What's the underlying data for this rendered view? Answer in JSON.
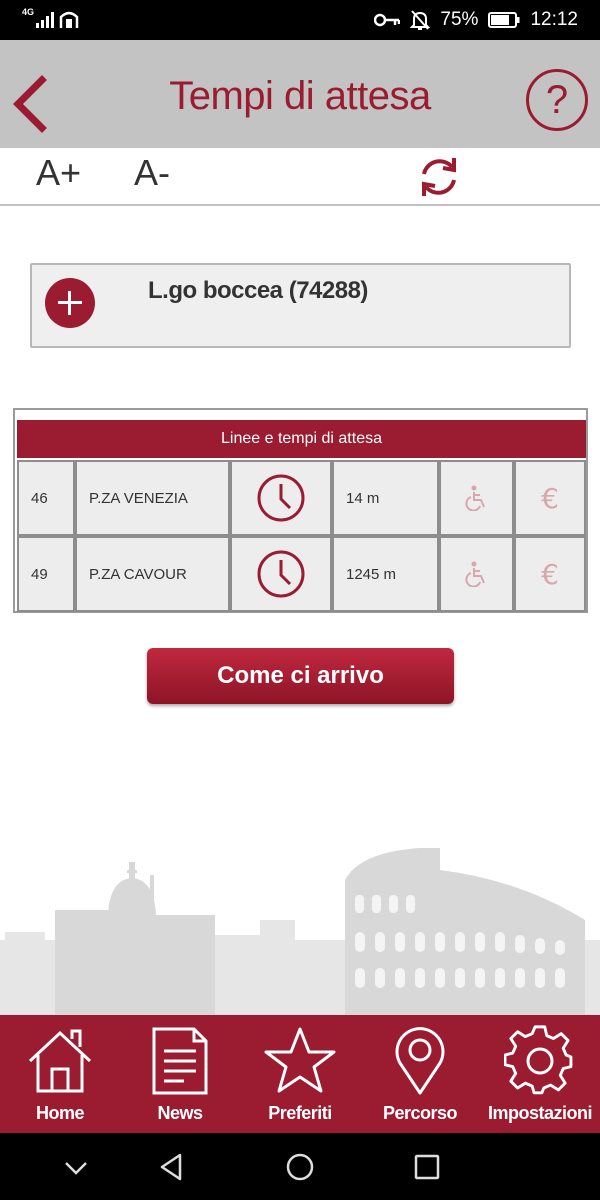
{
  "status_bar": {
    "network": "4G",
    "battery": "75%",
    "time": "12:12"
  },
  "header": {
    "title": "Tempi di attesa",
    "help_label": "?"
  },
  "font_toolbar": {
    "increase_label": "A+",
    "decrease_label": "A-"
  },
  "stop": {
    "name": "L.go boccea (74288)"
  },
  "lines_table": {
    "header": "Linee e tempi di attesa",
    "rows": [
      {
        "line": "46",
        "destination": "P.ZA VENEZIA",
        "wait": "14 m"
      },
      {
        "line": "49",
        "destination": "P.ZA CAVOUR",
        "wait": "1245 m"
      }
    ]
  },
  "route_button": "Come ci arrivo",
  "bottom_nav": [
    {
      "label": "Home",
      "icon": "home-icon"
    },
    {
      "label": "News",
      "icon": "news-icon"
    },
    {
      "label": "Preferiti",
      "icon": "star-icon"
    },
    {
      "label": "Percorso",
      "icon": "map-pin-icon"
    },
    {
      "label": "Impostazioni",
      "icon": "gear-icon"
    }
  ],
  "colors": {
    "accent": "#9b1b30",
    "header_bg": "#c3c3c3",
    "cell_bg": "#ededed"
  }
}
